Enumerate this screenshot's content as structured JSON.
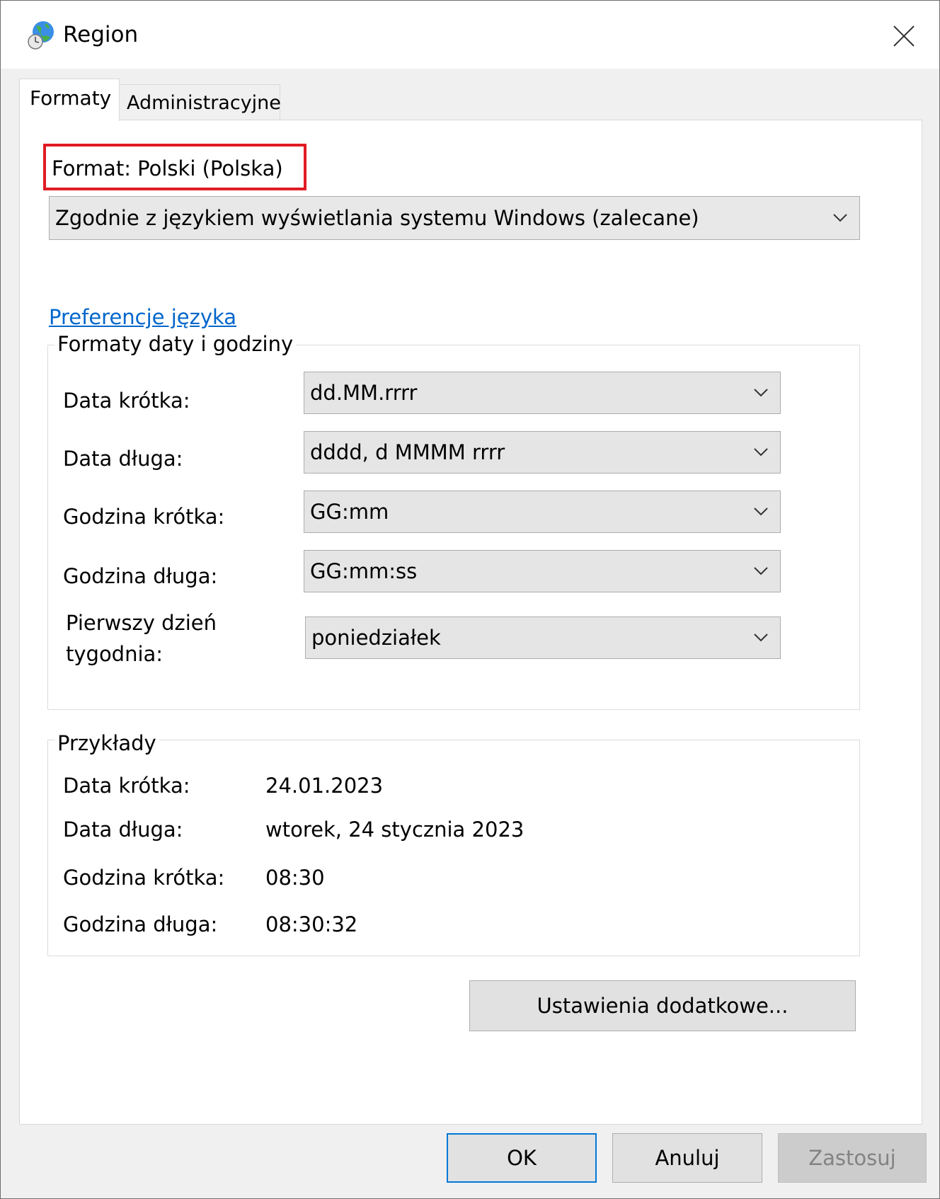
{
  "window": {
    "title": "Region",
    "icon": "globe-clock-icon",
    "close_icon": "close-icon"
  },
  "tabs": [
    {
      "label": "Formaty",
      "active": true
    },
    {
      "label": "Administracyjne",
      "active": false
    }
  ],
  "format": {
    "label": "Format: Polski (Polska)",
    "selected": "Zgodnie z językiem wyświetlania systemu Windows (zalecane)"
  },
  "language_link": "Preferencje języka",
  "datetime_group": {
    "title": "Formaty daty i godziny",
    "rows": [
      {
        "label": "Data krótka:",
        "value": "dd.MM.rrrr"
      },
      {
        "label": "Data długa:",
        "value": "dddd, d MMMM rrrr"
      },
      {
        "label": "Godzina krótka:",
        "value": "GG:mm"
      },
      {
        "label": "Godzina długa:",
        "value": "GG:mm:ss"
      },
      {
        "label_line1": "Pierwszy dzień",
        "label_line2": "tygodnia:",
        "value": "poniedziałek"
      }
    ]
  },
  "examples_group": {
    "title": "Przykłady",
    "rows": [
      {
        "label": "Data krótka:",
        "value": "24.01.2023"
      },
      {
        "label": "Data długa:",
        "value": "wtorek, 24 stycznia 2023"
      },
      {
        "label": "Godzina krótka:",
        "value": "08:30"
      },
      {
        "label": "Godzina długa:",
        "value": "08:30:32"
      }
    ]
  },
  "buttons": {
    "additional": "Ustawienia dodatkowe...",
    "ok": "OK",
    "cancel": "Anuluj",
    "apply": "Zastosuj"
  },
  "colors": {
    "highlight_border": "#e01b24",
    "link": "#0066cc",
    "ok_border": "#0078d7"
  }
}
